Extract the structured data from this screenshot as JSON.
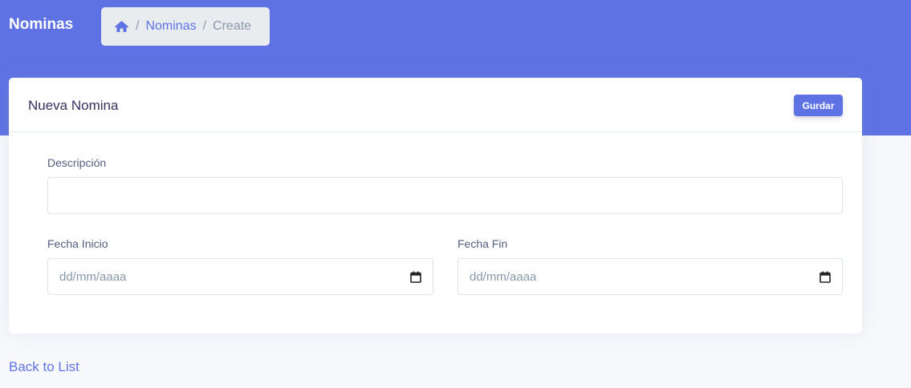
{
  "header": {
    "title": "Nominas",
    "breadcrumb": {
      "home_icon": "home-icon",
      "separator": "/",
      "items": [
        "Nominas",
        "Create"
      ]
    }
  },
  "card": {
    "title": "Nueva Nomina",
    "save_label": "Gurdar",
    "fields": {
      "descripcion": {
        "label": "Descripción",
        "value": ""
      },
      "fecha_inicio": {
        "label": "Fecha Inicio",
        "placeholder": "dd/mm/aaaa"
      },
      "fecha_fin": {
        "label": "Fecha Fin",
        "placeholder": "dd/mm/aaaa"
      }
    }
  },
  "footer": {
    "back_link": "Back to List"
  },
  "colors": {
    "primary": "#5e72e4",
    "breadcrumb_bg": "#e9ecef",
    "page_bg": "#f7f8fc"
  }
}
